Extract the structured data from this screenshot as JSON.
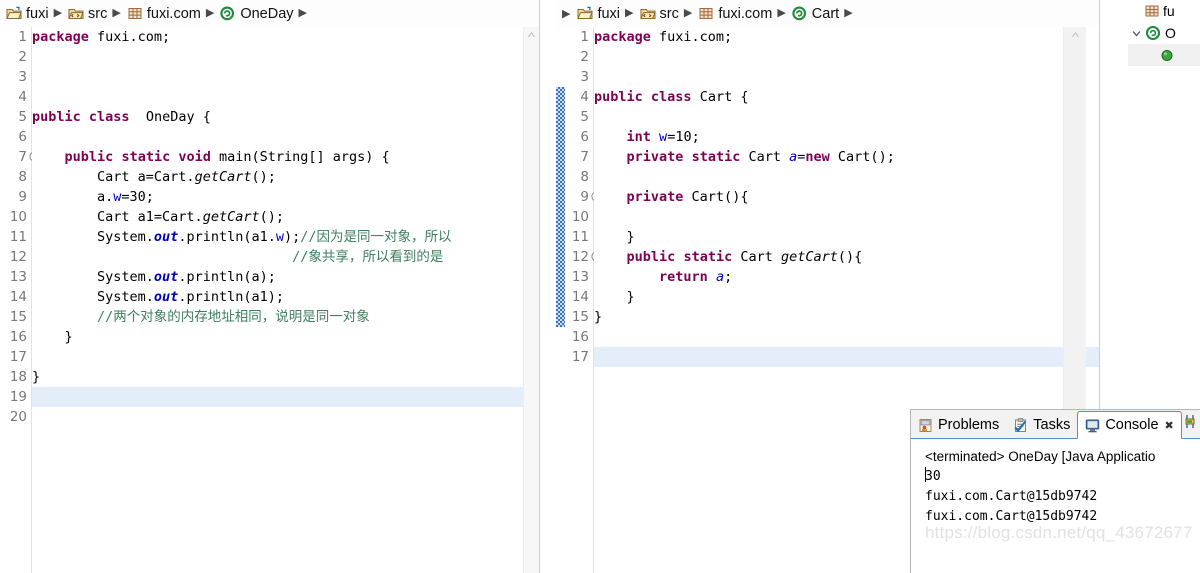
{
  "left_editor": {
    "breadcrumb": [
      {
        "icon": "project-folder-icon",
        "label": "fuxi"
      },
      {
        "icon": "source-folder-icon",
        "label": "src"
      },
      {
        "icon": "package-icon",
        "label": "fuxi.com"
      },
      {
        "icon": "java-class-icon",
        "label": "OneDay"
      }
    ],
    "lines": [
      {
        "n": "1",
        "fold": false,
        "hl": false
      },
      {
        "n": "2",
        "fold": false,
        "hl": false
      },
      {
        "n": "3",
        "fold": false,
        "hl": false
      },
      {
        "n": "4",
        "fold": false,
        "hl": false
      },
      {
        "n": "5",
        "fold": false,
        "hl": false
      },
      {
        "n": "6",
        "fold": false,
        "hl": false
      },
      {
        "n": "7",
        "fold": true,
        "hl": false
      },
      {
        "n": "8",
        "fold": false,
        "hl": false
      },
      {
        "n": "9",
        "fold": false,
        "hl": false
      },
      {
        "n": "10",
        "fold": false,
        "hl": false
      },
      {
        "n": "11",
        "fold": false,
        "hl": false
      },
      {
        "n": "12",
        "fold": false,
        "hl": false
      },
      {
        "n": "13",
        "fold": false,
        "hl": false
      },
      {
        "n": "14",
        "fold": false,
        "hl": false
      },
      {
        "n": "15",
        "fold": false,
        "hl": false
      },
      {
        "n": "16",
        "fold": false,
        "hl": false
      },
      {
        "n": "17",
        "fold": false,
        "hl": false
      },
      {
        "n": "18",
        "fold": false,
        "hl": false
      },
      {
        "n": "19",
        "fold": false,
        "hl": true
      },
      {
        "n": "20",
        "fold": false,
        "hl": false
      }
    ],
    "code_text": [
      "package fuxi.com;",
      "",
      "",
      "",
      "public class  OneDay {",
      "",
      "    public static void main(String[] args) {",
      "        Cart a=Cart.getCart();",
      "        a.w=30;",
      "        Cart a1=Cart.getCart();",
      "        System.out.println(a1.w);//因为是同一对象，所以",
      "                                //象共享，所以看到的是",
      "        System.out.println(a);",
      "        System.out.println(a1);",
      "        //两个对象的内存地址相同，说明是同一对象",
      "    }",
      "",
      "}",
      "",
      ""
    ]
  },
  "right_editor": {
    "breadcrumb": [
      {
        "icon": "project-folder-icon",
        "label": "fuxi"
      },
      {
        "icon": "source-folder-icon",
        "label": "src"
      },
      {
        "icon": "package-icon",
        "label": "fuxi.com"
      },
      {
        "icon": "java-class-icon",
        "label": "Cart"
      }
    ],
    "lines": [
      {
        "n": "1",
        "fold": false,
        "hl": false
      },
      {
        "n": "2",
        "fold": false,
        "hl": false
      },
      {
        "n": "3",
        "fold": false,
        "hl": false
      },
      {
        "n": "4",
        "fold": false,
        "hl": false
      },
      {
        "n": "5",
        "fold": false,
        "hl": false
      },
      {
        "n": "6",
        "fold": false,
        "hl": false
      },
      {
        "n": "7",
        "fold": false,
        "hl": false
      },
      {
        "n": "8",
        "fold": false,
        "hl": false
      },
      {
        "n": "9",
        "fold": true,
        "hl": false
      },
      {
        "n": "10",
        "fold": false,
        "hl": false
      },
      {
        "n": "11",
        "fold": false,
        "hl": false
      },
      {
        "n": "12",
        "fold": true,
        "hl": false
      },
      {
        "n": "13",
        "fold": false,
        "hl": false
      },
      {
        "n": "14",
        "fold": false,
        "hl": false
      },
      {
        "n": "15",
        "fold": false,
        "hl": false
      },
      {
        "n": "16",
        "fold": false,
        "hl": false
      },
      {
        "n": "17",
        "fold": false,
        "hl": true
      }
    ],
    "code_text": [
      "package fuxi.com;",
      "",
      "",
      "public class Cart {",
      "",
      "    int w=10;",
      "    private static Cart a=new Cart();",
      "",
      "    private Cart(){",
      "",
      "    }",
      "    public static Cart getCart(){",
      "        return a;",
      "    }",
      "}",
      "",
      ""
    ]
  },
  "outline": {
    "rows": [
      {
        "icon": "package-icon",
        "label": "fu"
      },
      {
        "icon": "java-class-icon",
        "label": "O",
        "chevron": "v"
      },
      {
        "icon": "public-member-icon",
        "label": ""
      }
    ]
  },
  "console": {
    "tabs": [
      {
        "label": "Problems",
        "icon": "problems-icon",
        "active": false,
        "closable": false
      },
      {
        "label": "Tasks",
        "icon": "tasks-icon",
        "active": false,
        "closable": false
      },
      {
        "label": "Console",
        "icon": "console-icon",
        "active": true,
        "closable": true,
        "close_glyph": "✖"
      }
    ],
    "launch_header": "<terminated> OneDay [Java Applicatio",
    "output": [
      "30",
      "fuxi.com.Cart@15db9742",
      "fuxi.com.Cart@15db9742"
    ],
    "watermark": "https://blog.csdn.net/qq_43672677"
  },
  "colors": {
    "keyword": "#7f0055",
    "comment": "#3f7f5f",
    "string": "#2a00ff",
    "field": "#0000c0",
    "current_line": "#e4eefb",
    "change_bar": "#3a6fc4",
    "tab_border": "#5a8fc4"
  }
}
